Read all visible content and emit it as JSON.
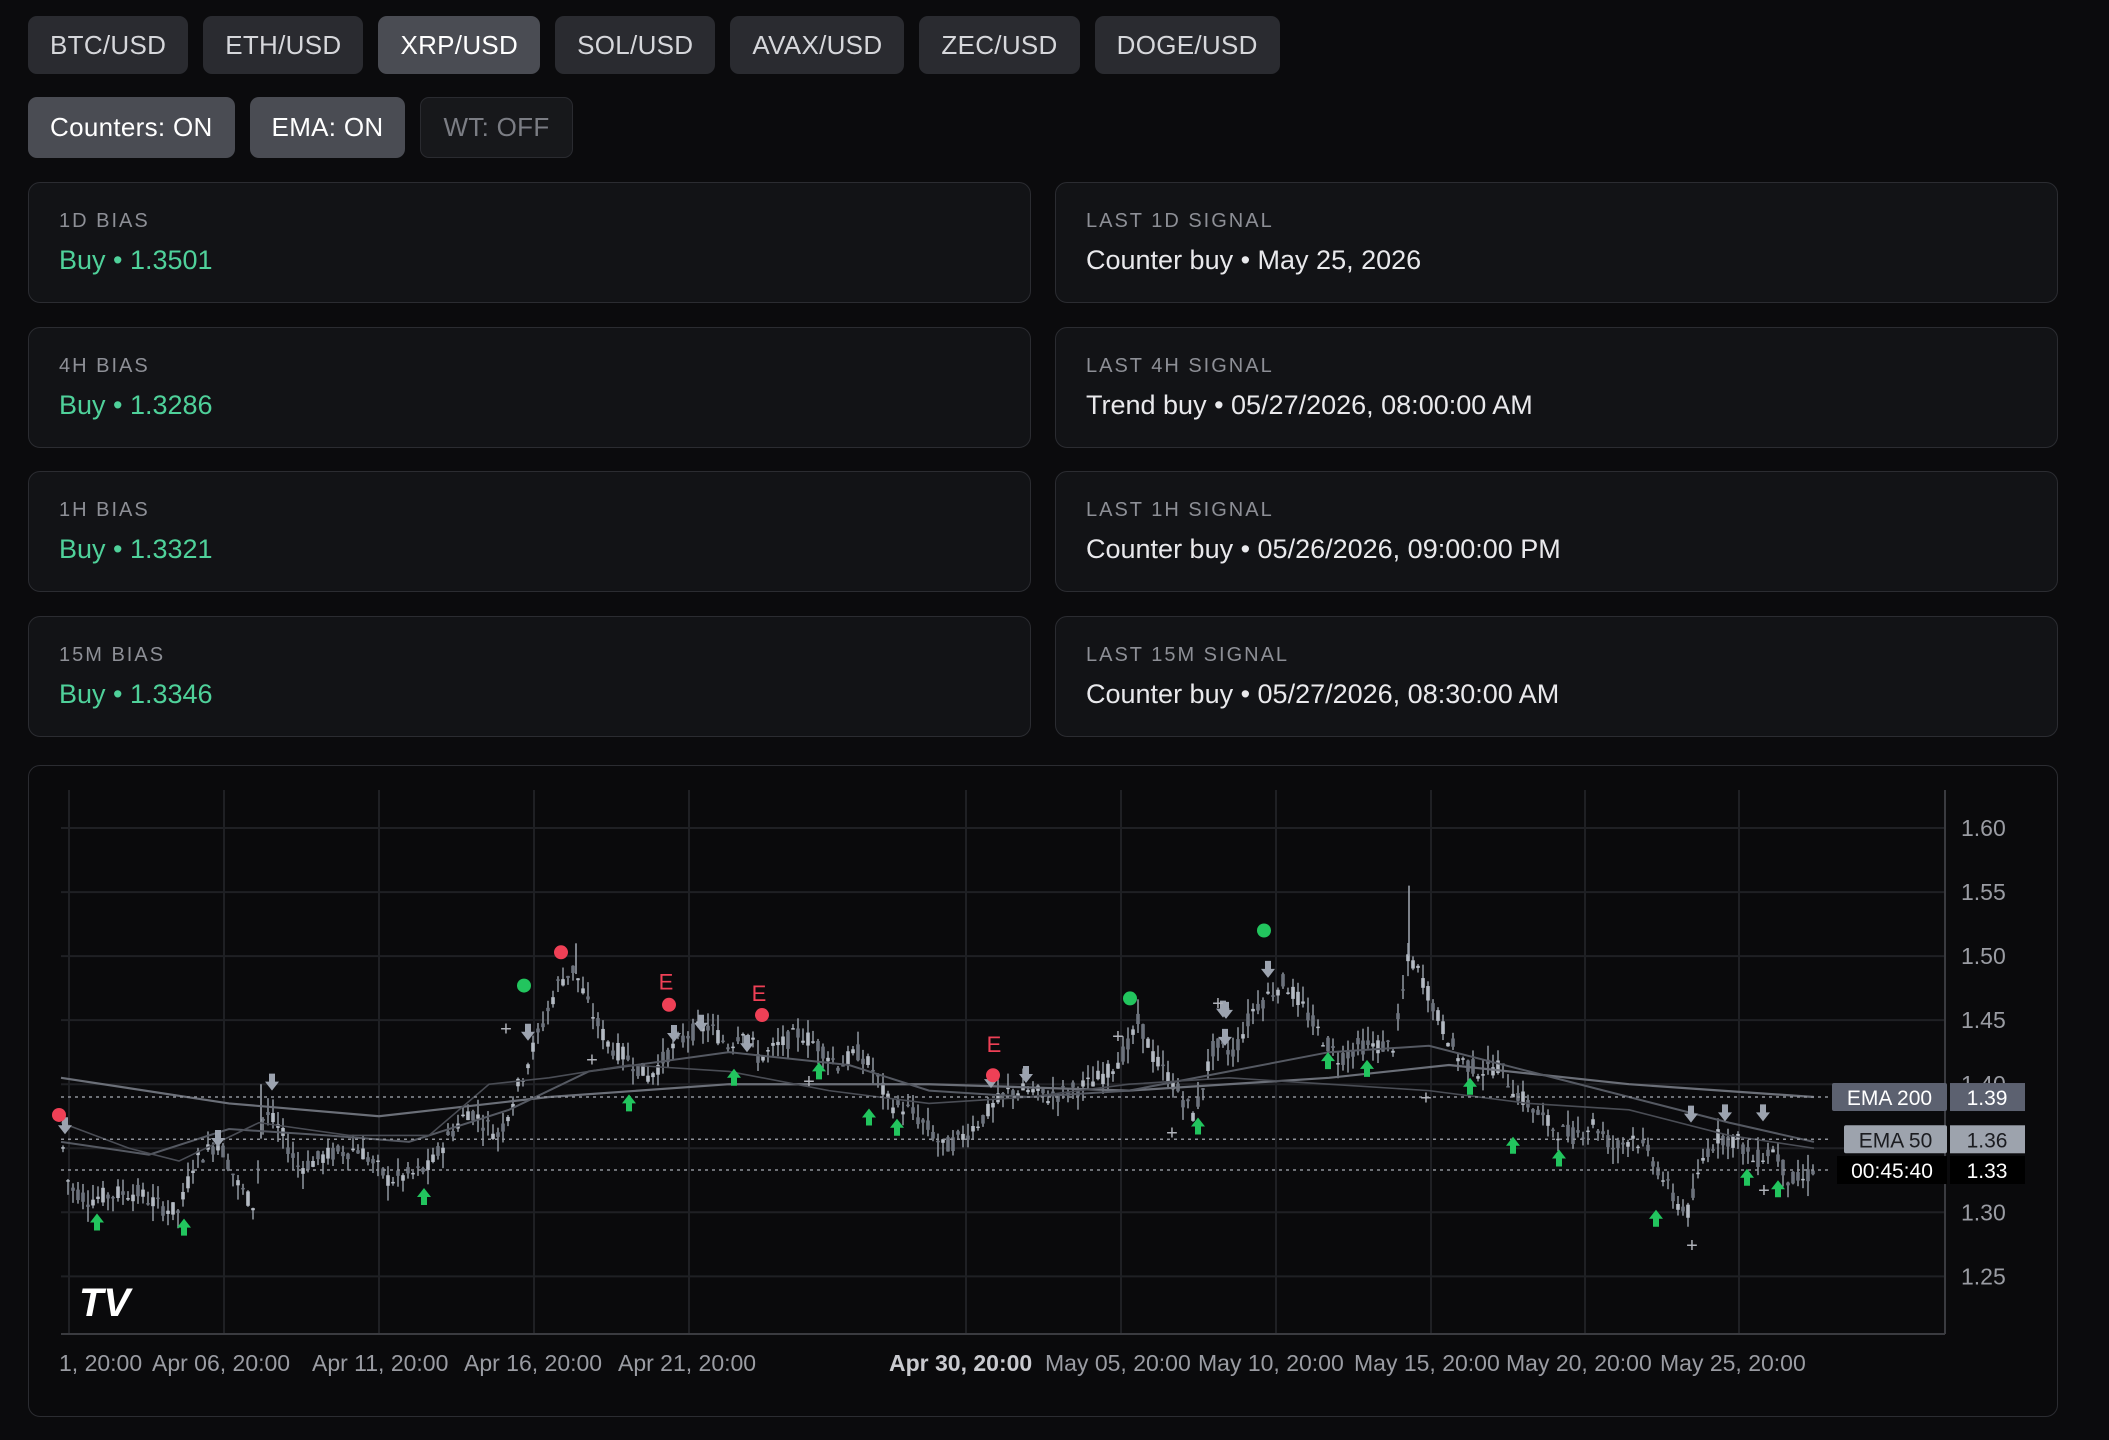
{
  "pairs": [
    {
      "label": "BTC/USD",
      "active": false
    },
    {
      "label": "ETH/USD",
      "active": false
    },
    {
      "label": "XRP/USD",
      "active": true
    },
    {
      "label": "SOL/USD",
      "active": false
    },
    {
      "label": "AVAX/USD",
      "active": false
    },
    {
      "label": "ZEC/USD",
      "active": false
    },
    {
      "label": "DOGE/USD",
      "active": false
    }
  ],
  "toggles": [
    {
      "label": "Counters: ON",
      "on": true
    },
    {
      "label": "EMA: ON",
      "on": true
    },
    {
      "label": "WT: OFF",
      "on": false
    }
  ],
  "bias": [
    {
      "label": "1D BIAS",
      "value": "Buy • 1.3501"
    },
    {
      "label": "4H BIAS",
      "value": "Buy • 1.3286"
    },
    {
      "label": "1H BIAS",
      "value": "Buy • 1.3321"
    },
    {
      "label": "15M BIAS",
      "value": "Buy • 1.3346"
    }
  ],
  "signals": [
    {
      "label": "LAST 1D SIGNAL",
      "value": "Counter buy • May 25, 2026"
    },
    {
      "label": "LAST 4H SIGNAL",
      "value": "Trend buy • 05/27/2026, 08:00:00 AM"
    },
    {
      "label": "LAST 1H SIGNAL",
      "value": "Counter buy • 05/26/2026, 09:00:00 PM"
    },
    {
      "label": "LAST 15M SIGNAL",
      "value": "Counter buy • 05/27/2026, 08:30:00 AM"
    }
  ],
  "colors": {
    "buy": "#4fd19a",
    "up_arrow": "#22c55e",
    "down_arrow": "#9ca3af",
    "sell_dot": "#ef4056",
    "buy_dot": "#22c55e",
    "candle": "#9aa1ab",
    "ema": "#6b6f78"
  },
  "chart": {
    "logo": "TV",
    "y_ticks": [
      "1.60",
      "1.55",
      "1.50",
      "1.45",
      "1.40",
      "1.30",
      "1.25"
    ],
    "x_ticks": [
      {
        "label": "1, 20:00",
        "bold": false
      },
      {
        "label": "Apr 06, 20:00",
        "bold": false
      },
      {
        "label": "Apr 11, 20:00",
        "bold": false
      },
      {
        "label": "Apr 16, 20:00",
        "bold": false
      },
      {
        "label": "Apr 21, 20:00",
        "bold": false
      },
      {
        "label": "Apr 30, 20:00",
        "bold": true
      },
      {
        "label": "May 05, 20:00",
        "bold": false
      },
      {
        "label": "May 10, 20:00",
        "bold": false
      },
      {
        "label": "May 15, 20:00",
        "bold": false
      },
      {
        "label": "May 20, 20:00",
        "bold": false
      },
      {
        "label": "May 25, 20:00",
        "bold": false
      }
    ],
    "price_tags": [
      {
        "label": "EMA 200",
        "value": "1.39",
        "price": 1.39
      },
      {
        "label": "EMA 50",
        "value": "1.36",
        "price": 1.357
      },
      {
        "label": "00:45:40",
        "value": "1.33",
        "price": 1.333
      }
    ],
    "marker_letter": "E"
  }
}
